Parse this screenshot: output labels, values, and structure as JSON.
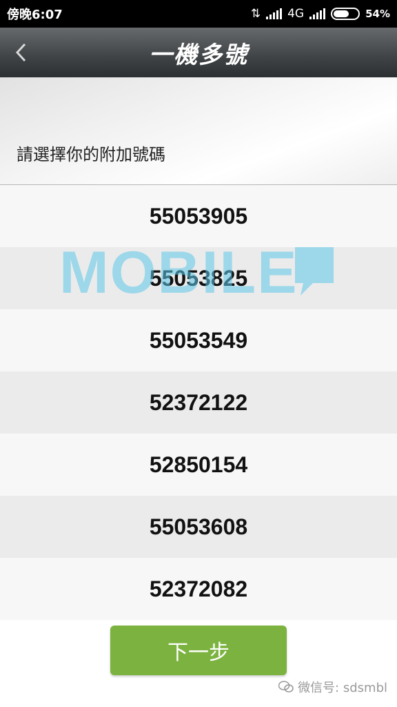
{
  "status_bar": {
    "time": "傍晚6:07",
    "network": "4G",
    "battery_pct": "54%",
    "battery_level": 0.54
  },
  "header": {
    "title": "一機多號",
    "back_icon": "chevron-left-icon"
  },
  "instruction": "請選擇你的附加號碼",
  "numbers": [
    "55053905",
    "55053825",
    "55053549",
    "52372122",
    "52850154",
    "55053608",
    "52372082"
  ],
  "next_button_label": "下一步",
  "watermark": {
    "logo_text": "MOBILE",
    "wechat_text": "微信号: sdsmbl"
  },
  "colors": {
    "accent_green": "#7cb340",
    "title_bar": "#3f4346",
    "watermark_blue": "#5ec8ea"
  }
}
